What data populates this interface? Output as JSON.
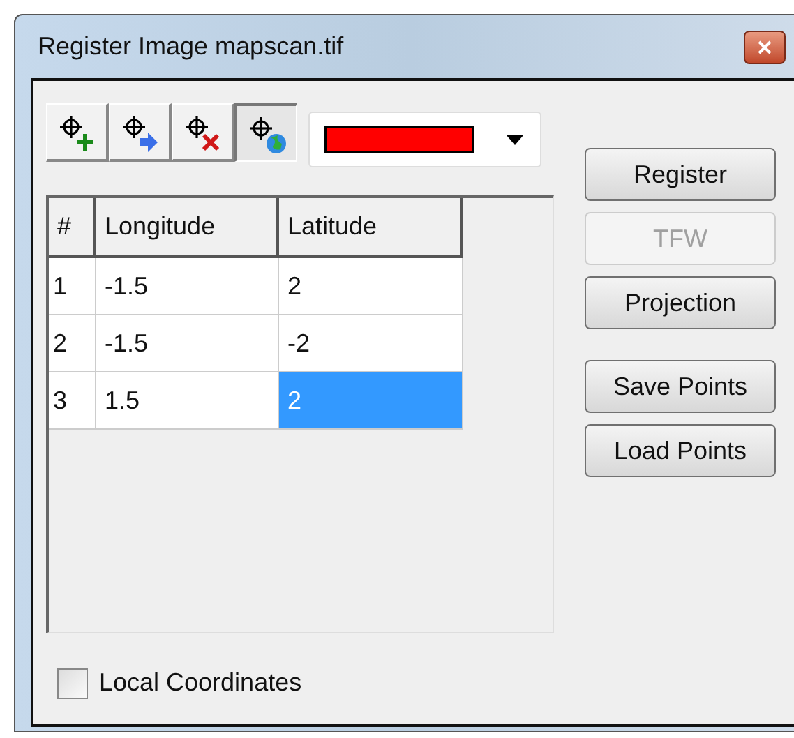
{
  "window": {
    "title": "Register Image mapscan.tif"
  },
  "toolbar": {
    "tools": [
      {
        "kind": "add",
        "selected": false
      },
      {
        "kind": "move",
        "selected": false
      },
      {
        "kind": "delete",
        "selected": false
      },
      {
        "kind": "globe",
        "selected": true
      }
    ],
    "color": "#ff0000"
  },
  "table": {
    "columns": [
      "#",
      "Longitude",
      "Latitude"
    ],
    "rows": [
      {
        "cells": [
          {
            "text": "1",
            "selected": false
          },
          {
            "text": "-1.5",
            "selected": false
          },
          {
            "text": "2",
            "selected": false
          }
        ]
      },
      {
        "cells": [
          {
            "text": "2",
            "selected": false
          },
          {
            "text": "-1.5",
            "selected": false
          },
          {
            "text": "-2",
            "selected": false
          }
        ]
      },
      {
        "cells": [
          {
            "text": "3",
            "selected": false
          },
          {
            "text": "1.5",
            "selected": false
          },
          {
            "text": "2",
            "selected": true
          }
        ]
      }
    ]
  },
  "buttons": [
    {
      "label": "Register",
      "disabled": false
    },
    {
      "label": "TFW",
      "disabled": true
    },
    {
      "label": "Projection",
      "disabled": false
    },
    {
      "label": "Save Points",
      "disabled": false
    },
    {
      "label": "Load Points",
      "disabled": false
    }
  ],
  "local_coordinates": {
    "label": "Local Coordinates",
    "checked": false
  }
}
